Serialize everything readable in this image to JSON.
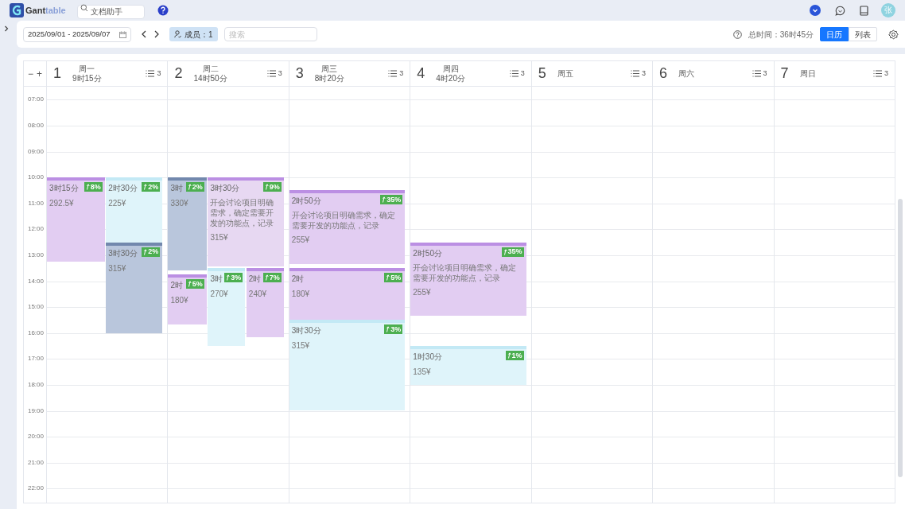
{
  "topbar": {
    "logo_dark": "Gant",
    "logo_light": "table",
    "search": {
      "placeholder": "文档助手"
    },
    "avatar": "张"
  },
  "toolbar": {
    "date_range": "2025/09/01 - 2025/09/07",
    "members": "成员：1",
    "search": {
      "placeholder": "搜索"
    },
    "total_time": "总时间：36时45分",
    "views": [
      {
        "label": "日历",
        "selected": true
      },
      {
        "label": "列表",
        "selected": false
      }
    ]
  },
  "calendar": {
    "zoom_out": "−",
    "zoom_in": "+",
    "hours": [
      "07:00",
      "08:00",
      "09:00",
      "10:00",
      "11:00",
      "12:00",
      "13:00",
      "14:00",
      "15:00",
      "16:00",
      "17:00",
      "18:00",
      "19:00",
      "20:00",
      "21:00",
      "22:00"
    ],
    "days": [
      {
        "number": "1",
        "weekday": "周一",
        "duration": "9时15分",
        "count": "3",
        "events": [
          {
            "color": "#e2cdf2",
            "duration": "3时15分",
            "percent": "8%",
            "price": "292.5¥"
          },
          {
            "color": "#dff4fa",
            "duration": "2时30分",
            "percent": "2%",
            "price": "225¥"
          },
          {
            "color": "#b9c6dc",
            "duration": "3时30分",
            "percent": "2%",
            "price": "315¥"
          }
        ]
      },
      {
        "number": "2",
        "weekday": "周二",
        "duration": "14时50分",
        "count": "3",
        "events": [
          {
            "color": "#b9c6dc",
            "duration": "3时",
            "percent": "2%",
            "price": "330¥"
          },
          {
            "color": "#e7d8f2",
            "duration": "3时30分",
            "percent": "9%",
            "description": "开会讨论项目明确需求，确定需要开发的功能点，记录",
            "price": "315¥"
          },
          {
            "color": "#e2cdf2",
            "duration": "2时",
            "percent": "5%",
            "price": "180¥"
          },
          {
            "color": "#dff4fa",
            "duration": "3时",
            "percent": "3%",
            "price": "270¥"
          },
          {
            "color": "#e2cdf2",
            "duration": "2时",
            "percent": "7%",
            "price": "240¥"
          }
        ]
      },
      {
        "number": "3",
        "weekday": "周三",
        "duration": "8时20分",
        "count": "3",
        "events": [
          {
            "color": "#e2cdf2",
            "duration": "2时50分",
            "percent": "35%",
            "description": "开会讨论项目明确需求，确定需要开发的功能点，记录",
            "price": "255¥"
          },
          {
            "color": "#e2cdf2",
            "duration": "2时",
            "percent": "5%",
            "price": "180¥"
          },
          {
            "color": "#dff4fa",
            "duration": "3时30分",
            "percent": "3%",
            "price": "315¥"
          }
        ]
      },
      {
        "number": "4",
        "weekday": "周四",
        "duration": "4时20分",
        "count": "3",
        "events": [
          {
            "color": "#e2cdf2",
            "duration": "2时50分",
            "percent": "35%",
            "description": "开会讨论项目明确需求，确定需要开发的功能点，记录",
            "price": "255¥"
          },
          {
            "color": "#dff4fa",
            "duration": "1时30分",
            "percent": "1%",
            "price": "135¥"
          }
        ]
      },
      {
        "number": "5",
        "weekday": "周五",
        "count": "3"
      },
      {
        "number": "6",
        "weekday": "周六",
        "count": "3"
      },
      {
        "number": "7",
        "weekday": "周日",
        "count": "3"
      }
    ]
  }
}
